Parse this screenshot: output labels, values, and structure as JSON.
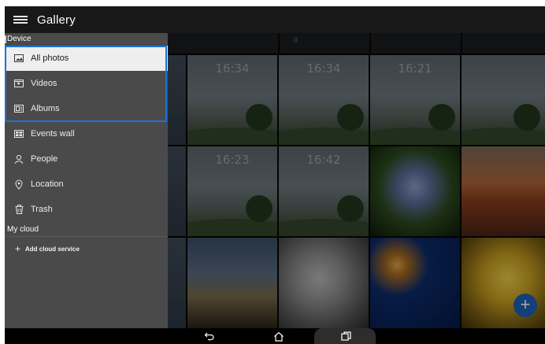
{
  "app": {
    "title": "Gallery"
  },
  "drawer": {
    "sections": {
      "device": "Device",
      "cloud": "My cloud"
    },
    "items": [
      {
        "label": "All photos",
        "icon": "photo-icon",
        "selected": true
      },
      {
        "label": "Videos",
        "icon": "video-icon",
        "selected": false
      },
      {
        "label": "Albums",
        "icon": "album-icon",
        "selected": false
      },
      {
        "label": "Events wall",
        "icon": "events-wall-icon",
        "selected": false
      },
      {
        "label": "People",
        "icon": "person-icon",
        "selected": false
      },
      {
        "label": "Location",
        "icon": "location-pin-icon",
        "selected": false
      },
      {
        "label": "Trash",
        "icon": "trash-icon",
        "selected": false
      }
    ],
    "add_cloud": "Add cloud service"
  },
  "grid": {
    "clocks": [
      "16:34",
      "16:34",
      "16:21",
      "16:23",
      "16:42"
    ],
    "strip_label": "0"
  },
  "colors": {
    "selection_outline": "#1b72d8",
    "drawer_bg": "#4a4a4a",
    "fab": "#1f63b8"
  }
}
